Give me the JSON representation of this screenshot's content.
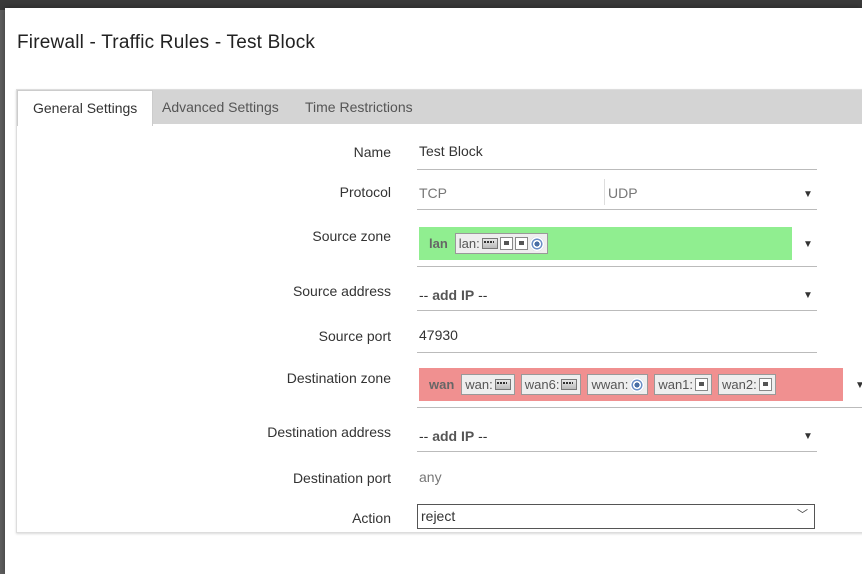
{
  "dialog": {
    "title": "Firewall - Traffic Rules - Test Block"
  },
  "tabs": [
    {
      "label": "General Settings",
      "active": true
    },
    {
      "label": "Advanced Settings",
      "active": false
    },
    {
      "label": "Time Restrictions",
      "active": false
    }
  ],
  "form": {
    "name": {
      "label": "Name",
      "value": "Test Block"
    },
    "protocol": {
      "label": "Protocol",
      "options": [
        "TCP",
        "UDP"
      ]
    },
    "source_zone": {
      "label": "Source zone",
      "zone": "lan",
      "color": "#90ee90",
      "networks": [
        {
          "name": "lan:",
          "icons": [
            "switch-icon",
            "ethernet-icon",
            "ethernet-icon",
            "wifi-icon"
          ]
        }
      ]
    },
    "source_address": {
      "label": "Source address",
      "placeholder_prefix": "-- ",
      "placeholder_bold": "add IP",
      "placeholder_suffix": " --"
    },
    "source_port": {
      "label": "Source port",
      "value": "47930"
    },
    "destination_zone": {
      "label": "Destination zone",
      "zone": "wan",
      "color": "#f09090",
      "networks": [
        {
          "name": "wan:",
          "icons": [
            "switch-icon"
          ]
        },
        {
          "name": "wan6:",
          "icons": [
            "switch-icon"
          ]
        },
        {
          "name": "wwan:",
          "icons": [
            "wifi-icon"
          ]
        },
        {
          "name": "wan1:",
          "icons": [
            "ethernet-icon"
          ]
        },
        {
          "name": "wan2:",
          "icons": [
            "ethernet-icon"
          ]
        }
      ]
    },
    "destination_address": {
      "label": "Destination address",
      "placeholder_prefix": "-- ",
      "placeholder_bold": "add IP",
      "placeholder_suffix": " --"
    },
    "destination_port": {
      "label": "Destination port",
      "placeholder": "any"
    },
    "action": {
      "label": "Action",
      "value": "reject"
    }
  }
}
